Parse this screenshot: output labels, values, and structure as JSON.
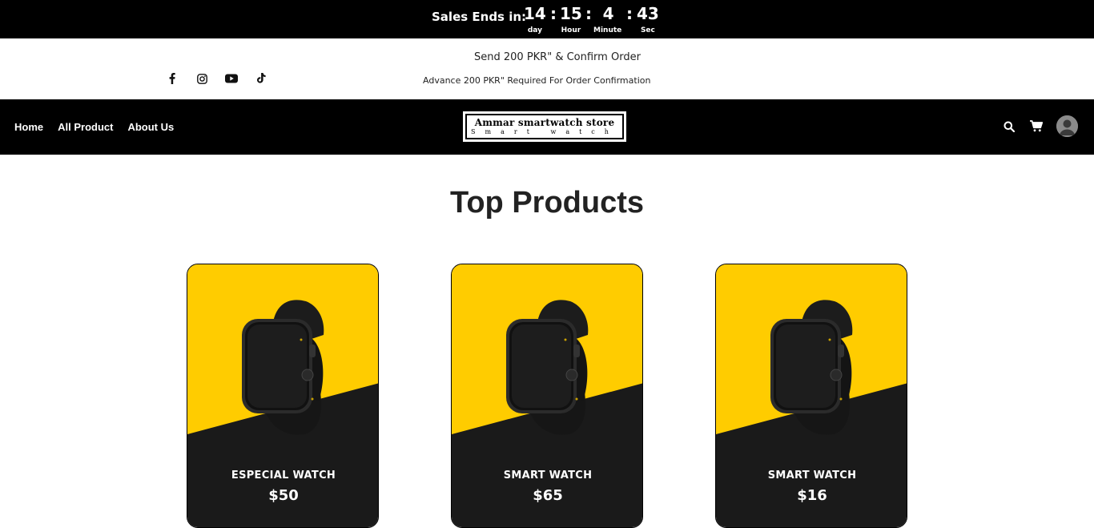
{
  "sale": {
    "label": "Sales Ends in:",
    "days": "14",
    "hours": "15",
    "minutes": "4",
    "seconds": "43",
    "sep": ":",
    "day_cap": "day",
    "hour_cap": "Hour",
    "minute_cap": "Minute",
    "sec_cap": "Sec"
  },
  "info": {
    "headline": "Send 200 PKR\" & Confirm Order",
    "subline": "Advance 200 PKR\" Required For Order Confirmation",
    "social": [
      "facebook-icon",
      "instagram-icon",
      "youtube-icon",
      "tiktok-icon"
    ]
  },
  "nav": {
    "links": [
      "Home",
      "All Product",
      "About Us"
    ],
    "logo_main": "Ammar smartwatch store",
    "logo_sub": "Smart watch"
  },
  "main": {
    "title": "Top Products",
    "products": [
      {
        "name": "ESPECIAL WATCH",
        "price": "$50"
      },
      {
        "name": "SMART WATCH",
        "price": "$65"
      },
      {
        "name": "SMART WATCH",
        "price": "$16"
      }
    ]
  },
  "colors": {
    "accent": "#ffcc00",
    "dark": "#1a1a1a",
    "bar": "#000000"
  }
}
